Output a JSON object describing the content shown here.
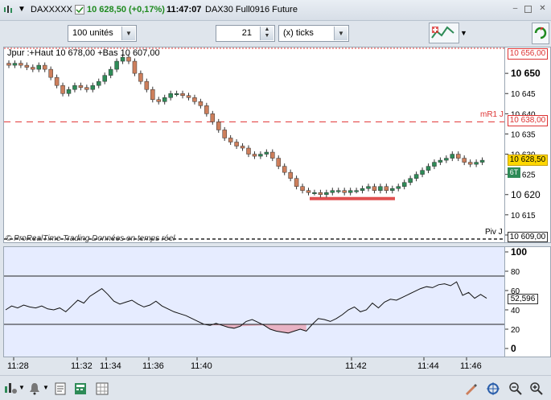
{
  "titlebar": {
    "symbol": "DAXXXXX",
    "price_change": "10 628,50 (+0,17%)",
    "time": "11:47:07",
    "instrument": "DAX30 Full0916 Future"
  },
  "toolbar": {
    "quantity_value": "100 unités",
    "ticks_value": "21",
    "ticks_unit": "(x) ticks"
  },
  "price_panel": {
    "header": "Jpur :+Haut 10 678,00 +Bas 10 607,00",
    "copyright": "© ProRealTime Trading  Données en temps réel",
    "mr1_label": "mR1 J",
    "piv_label": "Piv J",
    "axis_ticks": [
      "10 650",
      "10 645",
      "10 640",
      "10 635",
      "10 630",
      "10 625",
      "10 620",
      "10 615",
      "10 610"
    ],
    "badge_top": "10 656,00",
    "badge_mr1": "10 638,00",
    "badge_last": "10 628,50",
    "badge_piv": "10 609,00",
    "badge_6t": "6T",
    "colors": {
      "up": "#2e8b57",
      "down": "#cd7f5c",
      "resistance": "#e03030",
      "support_zone": "#e05050"
    }
  },
  "osc_panel": {
    "axis_ticks": [
      "100",
      "80",
      "60",
      "40",
      "20",
      "0"
    ],
    "badge_value": "52,596",
    "upper_level": 75,
    "lower_level": 25
  },
  "time_axis": [
    "11:28",
    "11:32",
    "11:34",
    "11:36",
    "11:40",
    "11:42",
    "11:44",
    "11:46"
  ],
  "chart_data": {
    "type": "candlestick",
    "price_range": [
      10609,
      10656
    ],
    "series": [
      {
        "name": "price",
        "close": [
          10652,
          10652.5,
          10652,
          10651.5,
          10651,
          10652,
          10651,
          10649,
          10647,
          10645,
          10646,
          10647,
          10646.5,
          10646,
          10647,
          10648,
          10649.5,
          10651,
          10653,
          10654,
          10653,
          10650,
          10648,
          10646,
          10643.5,
          10643,
          10644,
          10645,
          10645,
          10644.5,
          10644,
          10643,
          10642,
          10640,
          10638,
          10636,
          10634,
          10633,
          10632,
          10631.5,
          10630,
          10629.5,
          10630,
          10630.5,
          10629,
          10627,
          10625.5,
          10624,
          10622,
          10621,
          10620.5,
          10620.5,
          10620,
          10620.5,
          10621,
          10621,
          10620.5,
          10621,
          10621,
          10621.5,
          10622,
          10621,
          10622,
          10621,
          10621.5,
          10622,
          10623,
          10624,
          10625,
          10626,
          10627,
          10628,
          10628.5,
          10629,
          10630,
          10629,
          10628,
          10627.5,
          10628,
          10628.5
        ]
      },
      {
        "name": "oscillator",
        "values": [
          40,
          44,
          42,
          45,
          43,
          42,
          44,
          41,
          40,
          42,
          38,
          44,
          50,
          47,
          54,
          58,
          62,
          56,
          49,
          46,
          48,
          50,
          46,
          43,
          45,
          49,
          44,
          41,
          38,
          36,
          34,
          31,
          28,
          25,
          24,
          26,
          24,
          22,
          21,
          23,
          28,
          30,
          27,
          24,
          20,
          18,
          17,
          16,
          18,
          20,
          18,
          25,
          31,
          30,
          28,
          31,
          35,
          40,
          43,
          38,
          40,
          47,
          42,
          48,
          51,
          50,
          53,
          56,
          59,
          62,
          64,
          63,
          66,
          67,
          65,
          69,
          55,
          58,
          52,
          56,
          52
        ]
      }
    ],
    "oscillator_levels": [
      75,
      25
    ],
    "x_ticks": [
      "11:28",
      "11:32",
      "11:34",
      "11:36",
      "11:40",
      "11:42",
      "11:44",
      "11:46"
    ]
  }
}
